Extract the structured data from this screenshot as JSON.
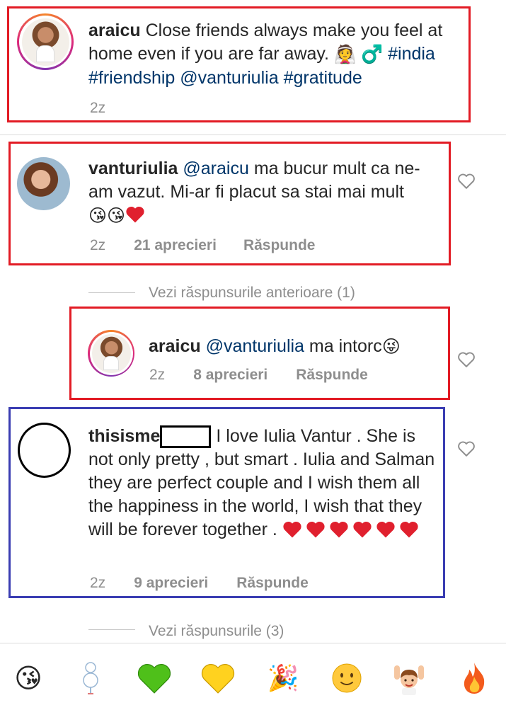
{
  "comments": [
    {
      "username": "araicu",
      "text": "Close friends always make you feel at home even if you are far away.",
      "text_emoji": "👰 ♂️",
      "hashtags": "#india #friendship",
      "mention": "@vanturiulia",
      "hashtag_end": "#gratitude",
      "time": "2z"
    },
    {
      "username": "vanturiulia",
      "mention": "@araicu",
      "text": "ma bucur mult ca ne-am vazut. Mi-ar fi placut sa stai mai mult",
      "time": "2z",
      "likes": "21 aprecieri",
      "reply_label": "Răspunde"
    },
    {
      "username": "araicu",
      "mention": "@vanturiulia",
      "text": "ma intorc",
      "time": "2z",
      "likes": "8 aprecieri",
      "reply_label": "Răspunde"
    },
    {
      "username": "thisisme",
      "text": "I love Iulia Vantur . She is not only pretty , but smart . Iulia and Salman they are perfect couple and I wish them all the happiness in the world, I wish that they will be forever together .",
      "time": "2z",
      "likes": "9 aprecieri",
      "reply_label": "Răspunde"
    }
  ],
  "view_previous_replies": "Vezi răspunsurile anterioare (1)",
  "view_replies": "Vezi răspunsurile (3)",
  "emoji_bar": [
    {
      "icon": "kissing-face-emoji",
      "glyph": "😘"
    },
    {
      "icon": "snowman-emoji",
      "glyph": "⛄"
    },
    {
      "icon": "green-heart-emoji",
      "glyph": "💚"
    },
    {
      "icon": "yellow-heart-emoji",
      "glyph": "💛"
    },
    {
      "icon": "party-popper-emoji",
      "glyph": "🎉"
    },
    {
      "icon": "smiling-face-emoji",
      "glyph": "🙂"
    },
    {
      "icon": "raising-hands-person-emoji",
      "glyph": "🙌"
    },
    {
      "icon": "fire-emoji",
      "glyph": "🔥"
    }
  ],
  "colors": {
    "annotation_red": "#e21b24",
    "annotation_blue": "#3a3db2",
    "hashtag": "#003569",
    "muted": "#8e8e8e"
  }
}
